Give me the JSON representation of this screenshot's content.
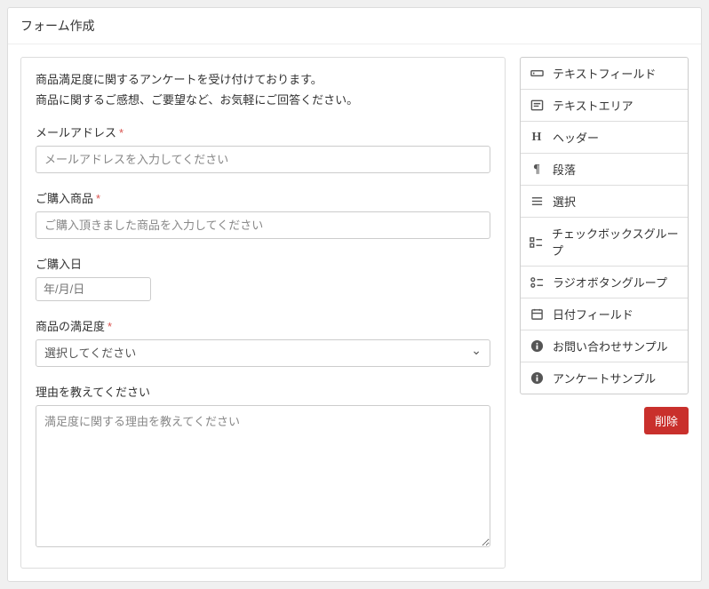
{
  "pageTitle": "フォーム作成",
  "intro": {
    "line1": "商品満足度に関するアンケートを受け付けております。",
    "line2": "商品に関するご感想、ご要望など、お気軽にご回答ください。"
  },
  "fields": {
    "email": {
      "label": "メールアドレス",
      "placeholder": "メールアドレスを入力してください"
    },
    "product": {
      "label": "ご購入商品",
      "placeholder": "ご購入頂きました商品を入力してください"
    },
    "purchaseDate": {
      "label": "ご購入日",
      "placeholder": "年/月/日"
    },
    "satisfaction": {
      "label": "商品の満足度",
      "placeholder": "選択してください"
    },
    "reason": {
      "label": "理由を教えてください",
      "placeholder": "満足度に関する理由を教えてください"
    }
  },
  "widgets": [
    {
      "icon": "text-field-icon",
      "label": "テキストフィールド"
    },
    {
      "icon": "text-area-icon",
      "label": "テキストエリア"
    },
    {
      "icon": "header-icon",
      "label": "ヘッダー"
    },
    {
      "icon": "paragraph-icon",
      "label": "段落"
    },
    {
      "icon": "select-icon",
      "label": "選択"
    },
    {
      "icon": "checkbox-group-icon",
      "label": "チェックボックスグループ"
    },
    {
      "icon": "radio-group-icon",
      "label": "ラジオボタングループ"
    },
    {
      "icon": "date-field-icon",
      "label": "日付フィールド"
    },
    {
      "icon": "info-icon",
      "label": "お問い合わせサンプル"
    },
    {
      "icon": "info-icon",
      "label": "アンケートサンプル"
    }
  ],
  "buttons": {
    "delete": "削除"
  }
}
